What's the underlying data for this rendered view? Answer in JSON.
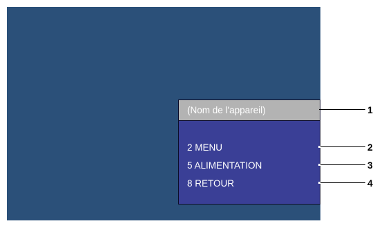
{
  "osd": {
    "title": "(Nom de l'appareil)",
    "items": [
      "2 MENU",
      "5 ALIMENTATION",
      "8 RETOUR"
    ]
  },
  "callouts": [
    "1",
    "2",
    "3",
    "4"
  ],
  "colors": {
    "screen": "#2b5079",
    "osd_body": "#3a3f96",
    "osd_title": "#b3b3b3"
  }
}
